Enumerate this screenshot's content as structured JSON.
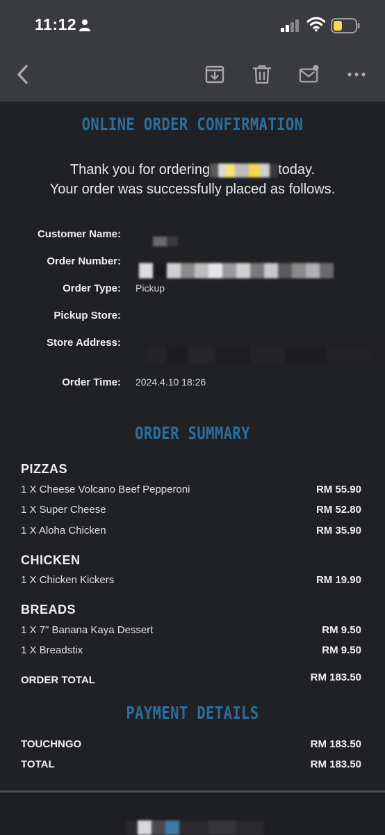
{
  "status_bar": {
    "time": "11:12"
  },
  "toolbar": {
    "back": "back-icon",
    "archive": "archive-icon",
    "delete": "trash-icon",
    "mark_unread": "mail-unread-icon",
    "more": "more-icon"
  },
  "email": {
    "heading": "ONLINE ORDER CONFIRMATION",
    "thanks_line1_prefix": "Thank you for ordering",
    "thanks_line1_suffix": "today.",
    "thanks_line2": "Your order was successfully placed as follows.",
    "details": {
      "customer_name_label": "Customer Name:",
      "order_number_label": "Order Number:",
      "order_type_label": "Order Type:",
      "order_type_value": "Pickup",
      "pickup_store_label": "Pickup Store:",
      "store_address_label": "Store Address:",
      "order_time_label": "Order Time:",
      "order_time_value": "2024.4.10 18:26"
    },
    "summary_heading": "ORDER SUMMARY",
    "categories": [
      {
        "name": "PIZZAS",
        "items": [
          {
            "name": "1 X Cheese Volcano Beef Pepperoni",
            "price": "RM 55.90"
          },
          {
            "name": "1 X Super Cheese",
            "price": "RM 52.80"
          },
          {
            "name": "1 X Aloha Chicken",
            "price": "RM 35.90"
          }
        ]
      },
      {
        "name": "CHICKEN",
        "items": [
          {
            "name": "1 X Chicken Kickers",
            "price": "RM 19.90"
          }
        ]
      },
      {
        "name": "BREADS",
        "items": [
          {
            "name": "1 X 7\" Banana Kaya Dessert",
            "price": "RM 9.50"
          },
          {
            "name": "1 X Breadstix",
            "price": "RM 9.50"
          }
        ]
      }
    ],
    "order_total_label": "ORDER TOTAL",
    "order_total_value": "RM 183.50",
    "payment_heading": "PAYMENT DETAILS",
    "payment_method_label": "TOUCHNGO",
    "payment_method_value": "RM 183.50",
    "total_label": "TOTAL",
    "total_value": "RM 183.50"
  },
  "colors": {
    "heading_blue": "#2c6f9e",
    "background": "#202125",
    "toolbar": "#3a3b3e",
    "battery_fill": "#f5d84e"
  }
}
